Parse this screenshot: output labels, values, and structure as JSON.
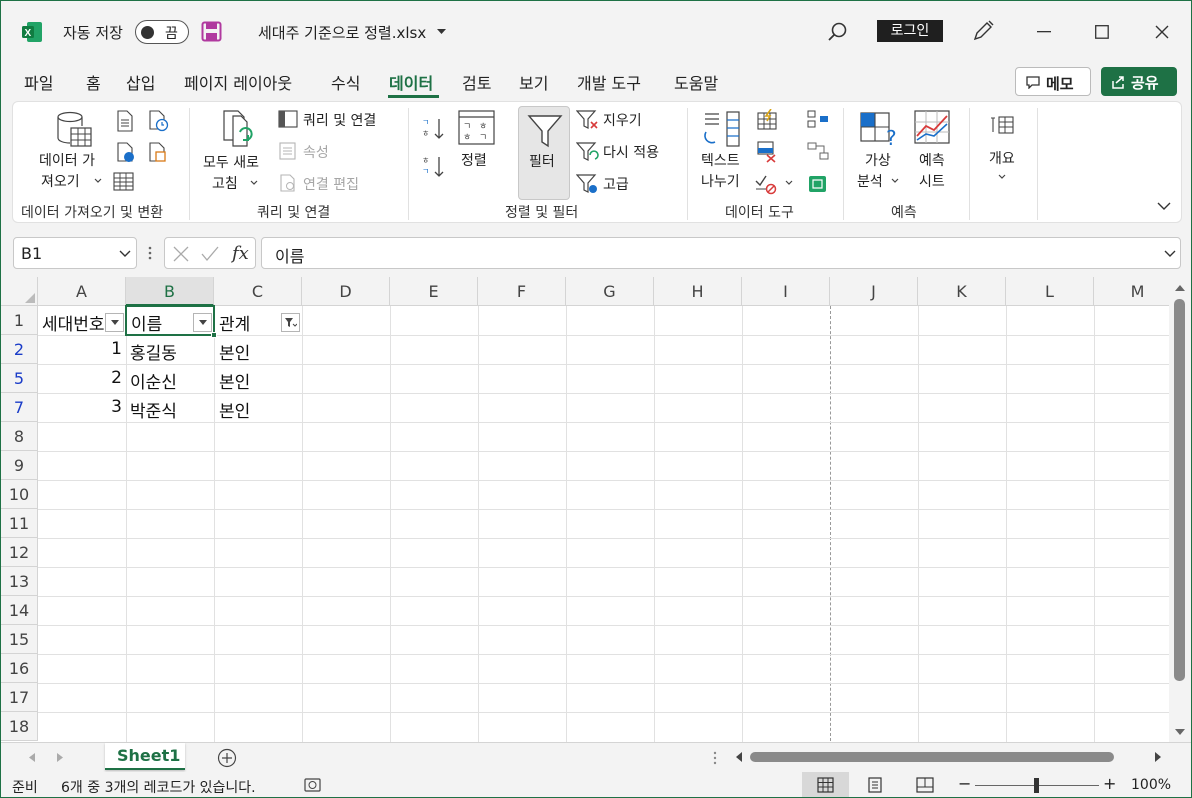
{
  "title_bar": {
    "autosave_label": "자동 저장",
    "autosave_state": "끔",
    "file_name": "세대주 기준으로 정렬.xlsx",
    "login_label": "로그인"
  },
  "tabs": [
    {
      "label": "파일"
    },
    {
      "label": "홈"
    },
    {
      "label": "삽입"
    },
    {
      "label": "페이지 레이아웃"
    },
    {
      "label": "수식"
    },
    {
      "label": "데이터",
      "active": true
    },
    {
      "label": "검토"
    },
    {
      "label": "보기"
    },
    {
      "label": "개발 도구"
    },
    {
      "label": "도움말"
    }
  ],
  "header_buttons": {
    "memo": "메모",
    "share": "공유"
  },
  "ribbon": {
    "get_data": {
      "line1": "데이터 가",
      "line2": "져오기"
    },
    "refresh_all": {
      "line1": "모두 새로",
      "line2": "고침"
    },
    "queries_connections": "쿼리 및 연결",
    "properties": "속성",
    "edit_links": "연결 편집",
    "sort": "정렬",
    "filter": "필터",
    "clear": "지우기",
    "reapply": "다시 적용",
    "advanced": "고급",
    "text_to_columns": {
      "line1": "텍스트",
      "line2": "나누기"
    },
    "what_if": {
      "line1": "가상",
      "line2": "분석"
    },
    "forecast_sheet": {
      "line1": "예측",
      "line2": "시트"
    },
    "outline": "개요",
    "group_labels": {
      "get_transform": "데이터 가져오기 및 변환",
      "queries": "쿼리 및 연결",
      "sort_filter": "정렬 및 필터",
      "data_tools": "데이터 도구",
      "forecast": "예측"
    }
  },
  "formula_bar": {
    "name_box": "B1",
    "content": "이름"
  },
  "columns": [
    "A",
    "B",
    "C",
    "D",
    "E",
    "F",
    "G",
    "H",
    "I",
    "J",
    "K",
    "L",
    "M"
  ],
  "row_numbers": [
    "1",
    "2",
    "5",
    "7",
    "8",
    "9",
    "10",
    "11",
    "12",
    "13",
    "14",
    "15",
    "16",
    "17",
    "18"
  ],
  "cells": {
    "header": {
      "a": "세대번호",
      "b": "이름",
      "c": "관계"
    },
    "rows": [
      {
        "a": "1",
        "b": "홍길동",
        "c": "본인"
      },
      {
        "a": "2",
        "b": "이순신",
        "c": "본인"
      },
      {
        "a": "3",
        "b": "박준식",
        "c": "본인"
      }
    ]
  },
  "sheet_tab": "Sheet1",
  "status": {
    "ready": "준비",
    "record_info": "6개 중 3개의 레코드가 있습니다.",
    "zoom": "100%"
  },
  "colors": {
    "accent": "#1e7145",
    "filtered_row": "#1a3cc8"
  }
}
